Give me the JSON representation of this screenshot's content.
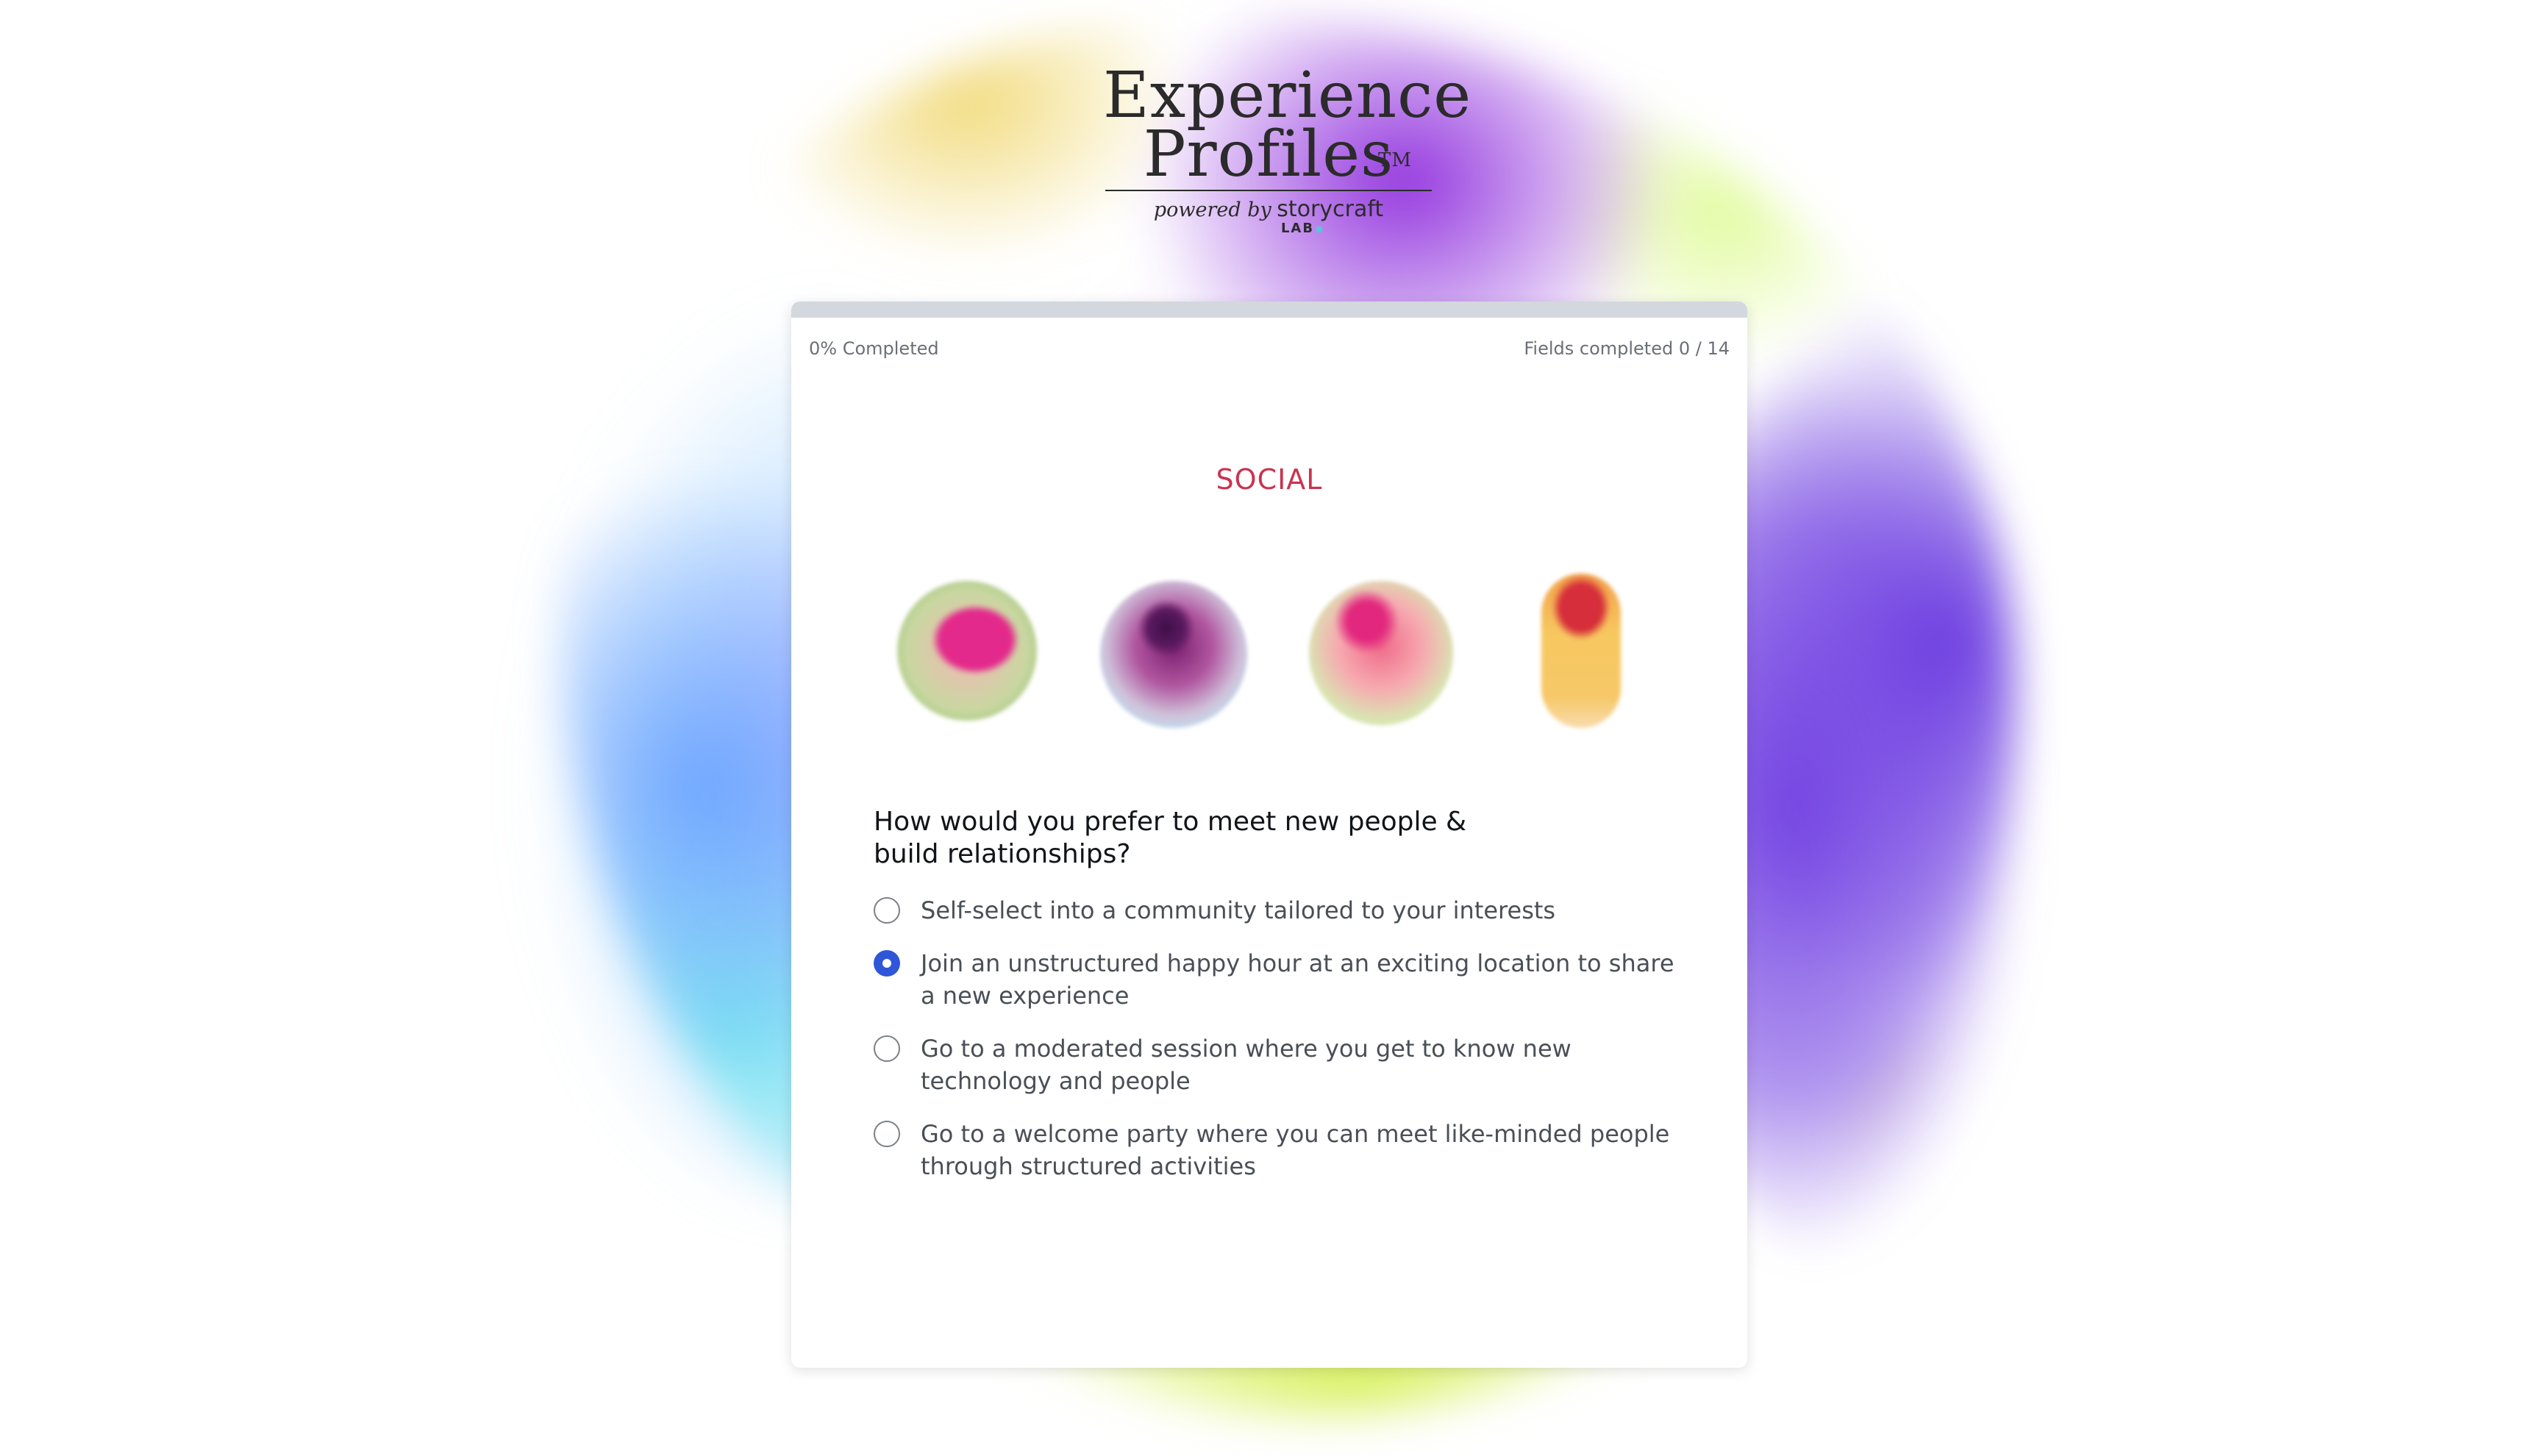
{
  "logo": {
    "title_line1": "Experience",
    "title_line2": "Profiles",
    "trademark": "TM",
    "powered_by": "powered by",
    "brand": "storycraft",
    "brand_sub": "LAB"
  },
  "progress": {
    "percent": 0,
    "completed_label": "0% Completed",
    "fields_label": "Fields completed 0 / 14",
    "fields_completed": 0,
    "fields_total": 14
  },
  "section": {
    "title": "SOCIAL"
  },
  "question": {
    "text": "How would you prefer to meet new people & build relationships?",
    "options": [
      {
        "label": "Self-select into a community tailored to your interests",
        "selected": false
      },
      {
        "label": "Join an unstructured happy hour at an exciting location to share a new experience",
        "selected": true
      },
      {
        "label": "Go to a moderated session where you get to know new technology and people",
        "selected": false
      },
      {
        "label": "Go to a welcome party where you can meet like-minded people through structured activities",
        "selected": false
      }
    ]
  },
  "colors": {
    "accent": "#2f56d8",
    "section_title": "#c9344f",
    "progress_track": "#d3d7de"
  }
}
